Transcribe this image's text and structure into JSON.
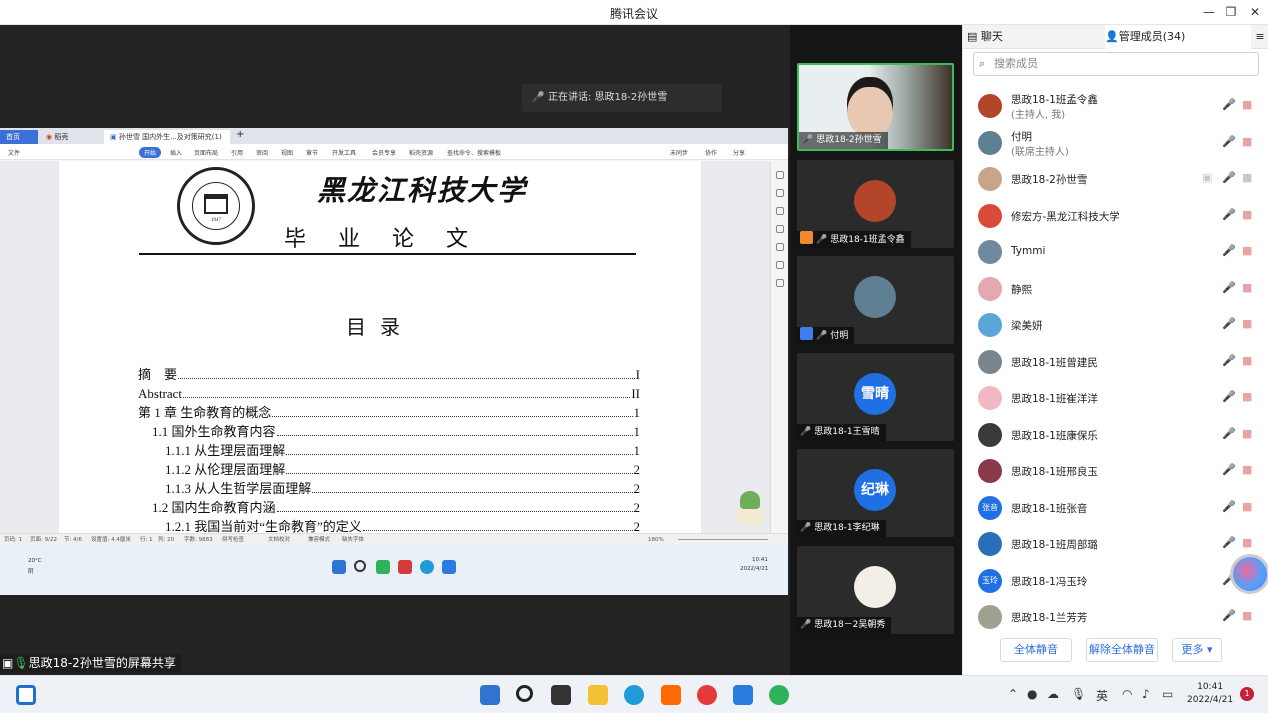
{
  "window": {
    "title": "腾讯会议",
    "minimize": "—",
    "restore": "❐",
    "close": "✕"
  },
  "speaking": {
    "text": "正在讲话: 思政18-2孙世雪",
    "icon": "mic-muted-icon"
  },
  "remote": {
    "tabs": {
      "home": "首页",
      "red": "稻壳",
      "doc": "孙世雪 国内外生...及对策研究(1)"
    },
    "menu": {
      "file": "文件",
      "start": "开始",
      "insert": "插入",
      "layout": "页面布局",
      "refs": "引用",
      "review": "审阅",
      "view": "视图",
      "section": "章节",
      "devtools": "开发工具",
      "member": "会员专享",
      "resource": "稻壳资源",
      "search": "查找命令、搜索模板",
      "sync": "未同步",
      "coop": "协作",
      "share": "分享"
    },
    "doc": {
      "university": "黑龙江科技大学",
      "emblem_year": "1947",
      "thesis": "毕业论文",
      "toc_title": "目录",
      "toc": [
        {
          "text": "摘　要",
          "page": "I",
          "indent": 0
        },
        {
          "text": "Abstract",
          "page": "II",
          "indent": 0
        },
        {
          "text": "第 1 章  生命教育的概念",
          "page": "1",
          "indent": 0
        },
        {
          "text": "1.1  国外生命教育内容",
          "page": "1",
          "indent": 1
        },
        {
          "text": "1.1.1  从生理层面理解",
          "page": "1",
          "indent": 2
        },
        {
          "text": "1.1.2  从伦理层面理解",
          "page": "2",
          "indent": 2
        },
        {
          "text": "1.1.3  从人生哲学层面理解",
          "page": "2",
          "indent": 2
        },
        {
          "text": "1.2  国内生命教育内涵",
          "page": "2",
          "indent": 1
        },
        {
          "text": "1.2.1  我国当前对“生命教育”的定义",
          "page": "2",
          "indent": 2
        }
      ]
    },
    "status": {
      "section": "页码: 1",
      "page": "页面: 9/22",
      "sec": "节: 4/6",
      "setting": "设置值: 4.4厘米",
      "row": "行: 1",
      "col": "列: 20",
      "words": "字数: 9883",
      "spell": "拼写检查",
      "proof": "文档校对",
      "protect": "兼容模式",
      "font": "缺失字体",
      "zoom": "180%"
    },
    "taskbar": {
      "weather_temp": "20°C",
      "weather_desc": "阴",
      "time": "10:41",
      "date": "2022/4/21"
    }
  },
  "tiles": [
    {
      "name": "思政18-2孙世雪",
      "type": "camera",
      "mic": "on",
      "active": true
    },
    {
      "name": "思政18-1班孟令鑫",
      "type": "avatar-img",
      "mic": "off",
      "host": "orange",
      "color": "#b3452a"
    },
    {
      "name": "付明",
      "type": "avatar-img",
      "mic": "off",
      "host": "blue",
      "color": "#5f7f92"
    },
    {
      "name": "思政18-1王雪晴",
      "type": "avatar-text",
      "avatar": "雪晴",
      "mic": "off",
      "color": "#1f6fe5"
    },
    {
      "name": "思政18-1李纪琳",
      "type": "avatar-text",
      "avatar": "纪琳",
      "mic": "off",
      "color": "#1f6fe5"
    },
    {
      "name": "思政18－2吴朝秀",
      "type": "avatar-img",
      "mic": "off",
      "color": "#f4efe6"
    }
  ],
  "share_label": "思政18-2孙世雪的屏幕共享",
  "panel": {
    "tabs": {
      "chat": "聊天",
      "members": "管理成员(34)"
    },
    "search_placeholder": "搜索成员",
    "members": [
      {
        "name": "思政18-1班孟令鑫",
        "role": "(主持人, 我)",
        "color": "#b3452a",
        "mic": "off",
        "video": "off"
      },
      {
        "name": "付明",
        "role": "(联席主持人)",
        "color": "#5f7f92",
        "mic": "off",
        "video": "off"
      },
      {
        "name": "思政18-2孙世雪",
        "role": "",
        "color": "#c9a48a",
        "mic": "on",
        "video": "on"
      },
      {
        "name": "修宏方-黑龙江科技大学",
        "role": "",
        "color": "#d94a3a",
        "mic": "idle",
        "video": "off"
      },
      {
        "name": "Tymmi",
        "role": "",
        "color": "#6f8aa0",
        "mic": "off",
        "video": "off"
      },
      {
        "name": "静熙",
        "role": "",
        "color": "#e4a8b0",
        "mic": "off",
        "video": "off"
      },
      {
        "name": "梁美妍",
        "role": "",
        "color": "#5aa6d6",
        "mic": "off",
        "video": "off"
      },
      {
        "name": "思政18-1班曾建民",
        "role": "",
        "color": "#7a8590",
        "mic": "off",
        "video": "off"
      },
      {
        "name": "思政18-1班崔洋洋",
        "role": "",
        "color": "#f2b8c4",
        "mic": "off",
        "video": "off"
      },
      {
        "name": "思政18-1班康保乐",
        "role": "",
        "color": "#3a3a3a",
        "mic": "off",
        "video": "off"
      },
      {
        "name": "思政18-1班邢良玉",
        "role": "",
        "color": "#8a3a4a",
        "mic": "off",
        "video": "off"
      },
      {
        "name": "思政18-1班张音",
        "role": "",
        "avatar": "张音",
        "color": "#1f6fe5",
        "mic": "off",
        "video": "off"
      },
      {
        "name": "思政18-1班周部璐",
        "role": "",
        "color": "#2a70b8",
        "mic": "off",
        "video": "off"
      },
      {
        "name": "思政18-1冯玉玲",
        "role": "",
        "avatar": "玉玲",
        "color": "#1f6fe5",
        "mic": "off",
        "video": "off"
      },
      {
        "name": "思政18-1兰芳芳",
        "role": "",
        "color": "#a0a090",
        "mic": "off",
        "video": "off"
      }
    ],
    "buttons": {
      "mute_all": "全体静音",
      "unmute_all": "解除全体静音",
      "more": "更多 ▾"
    }
  },
  "taskbar": {
    "time": "10:41",
    "date": "2022/4/21",
    "notifications": "1",
    "ime": "英"
  },
  "colors": {
    "accent": "#2f6fde",
    "active_border": "#3bbf5a",
    "muted": "#e8a3a3"
  }
}
